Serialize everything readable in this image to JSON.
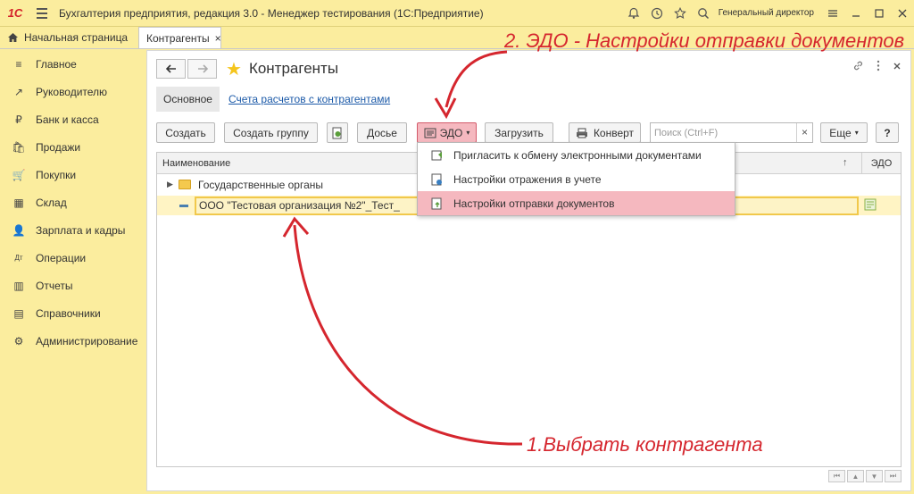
{
  "titlebar": {
    "logo": "1С",
    "title": "Бухгалтерия предприятия, редакция 3.0 - Менеджер тестирования (1С:Предприятие)",
    "user": "Генеральный директор"
  },
  "tabs": {
    "home": "Начальная страница",
    "active": "Контрагенты",
    "close": "×"
  },
  "sidebar": {
    "items": [
      {
        "label": "Главное",
        "icon": "≡"
      },
      {
        "label": "Руководителю",
        "icon": "↗"
      },
      {
        "label": "Банк и касса",
        "icon": "₽"
      },
      {
        "label": "Продажи",
        "icon": "🛍"
      },
      {
        "label": "Покупки",
        "icon": "🛒"
      },
      {
        "label": "Склад",
        "icon": "▦"
      },
      {
        "label": "Зарплата и кадры",
        "icon": "👤"
      },
      {
        "label": "Операции",
        "icon": "Дт"
      },
      {
        "label": "Отчеты",
        "icon": "▥"
      },
      {
        "label": "Справочники",
        "icon": "▤"
      },
      {
        "label": "Администрирование",
        "icon": "⚙"
      }
    ]
  },
  "main": {
    "title": "Контрагенты",
    "subtab_active": "Основное",
    "subtab_link": "Счета расчетов с контрагентами"
  },
  "toolbar": {
    "create": "Создать",
    "create_group": "Создать группу",
    "dossier": "Досье",
    "edo": "ЭДО",
    "load": "Загрузить",
    "envelope": "Конверт",
    "search_placeholder": "Поиск (Ctrl+F)",
    "clear": "×",
    "more": "Еще",
    "help": "?"
  },
  "table": {
    "col_name": "Наименование",
    "sort": "↑",
    "col_edo": "ЭДО",
    "rows": [
      {
        "name": "Государственные органы"
      },
      {
        "name": "ООО \"Тестовая организация №2\"_Тест_"
      }
    ]
  },
  "dropdown": {
    "items": [
      {
        "label": "Пригласить к обмену электронными документами"
      },
      {
        "label": "Настройки отражения в учете"
      },
      {
        "label": "Настройки отправки документов"
      }
    ]
  },
  "annotations": {
    "step2": "2. ЭДО - Настройки отправки документов",
    "step1": "1.Выбрать контрагента"
  },
  "colors": {
    "accent": "#fbed9e",
    "highlight": "#f5b8bf",
    "link": "#1c5aa8",
    "annotation": "#d5262e"
  }
}
